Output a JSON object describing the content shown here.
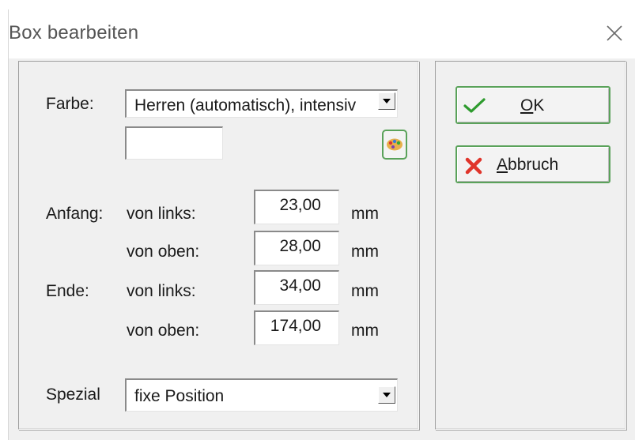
{
  "window": {
    "title": "Box bearbeiten"
  },
  "form": {
    "farbe_label": "Farbe:",
    "farbe_value": "Herren (automatisch), intensiv",
    "color_preview": "",
    "anfang_label": "Anfang:",
    "ende_label": "Ende:",
    "von_links": "von links:",
    "von_oben": "von oben:",
    "unit": "mm",
    "anfang_links": "23,00",
    "anfang_oben": "28,00",
    "ende_links": "34,00",
    "ende_oben": "174,00",
    "spezial_label": "Spezial",
    "spezial_value": "fixe Position"
  },
  "buttons": {
    "ok_mnemonic": "O",
    "ok_rest": "K",
    "cancel_mnemonic": "A",
    "cancel_rest": "bbruch"
  },
  "icons": {
    "close": "close-icon",
    "dropdown": "chevron-down-icon",
    "palette": "palette-icon",
    "ok": "checkmark-icon",
    "cancel": "x-icon"
  },
  "colors": {
    "button_border": "#5aa25a",
    "checkmark": "#2e9b2e",
    "cancel_x": "#e0352b",
    "dialog_bg": "#f0f0f0"
  }
}
